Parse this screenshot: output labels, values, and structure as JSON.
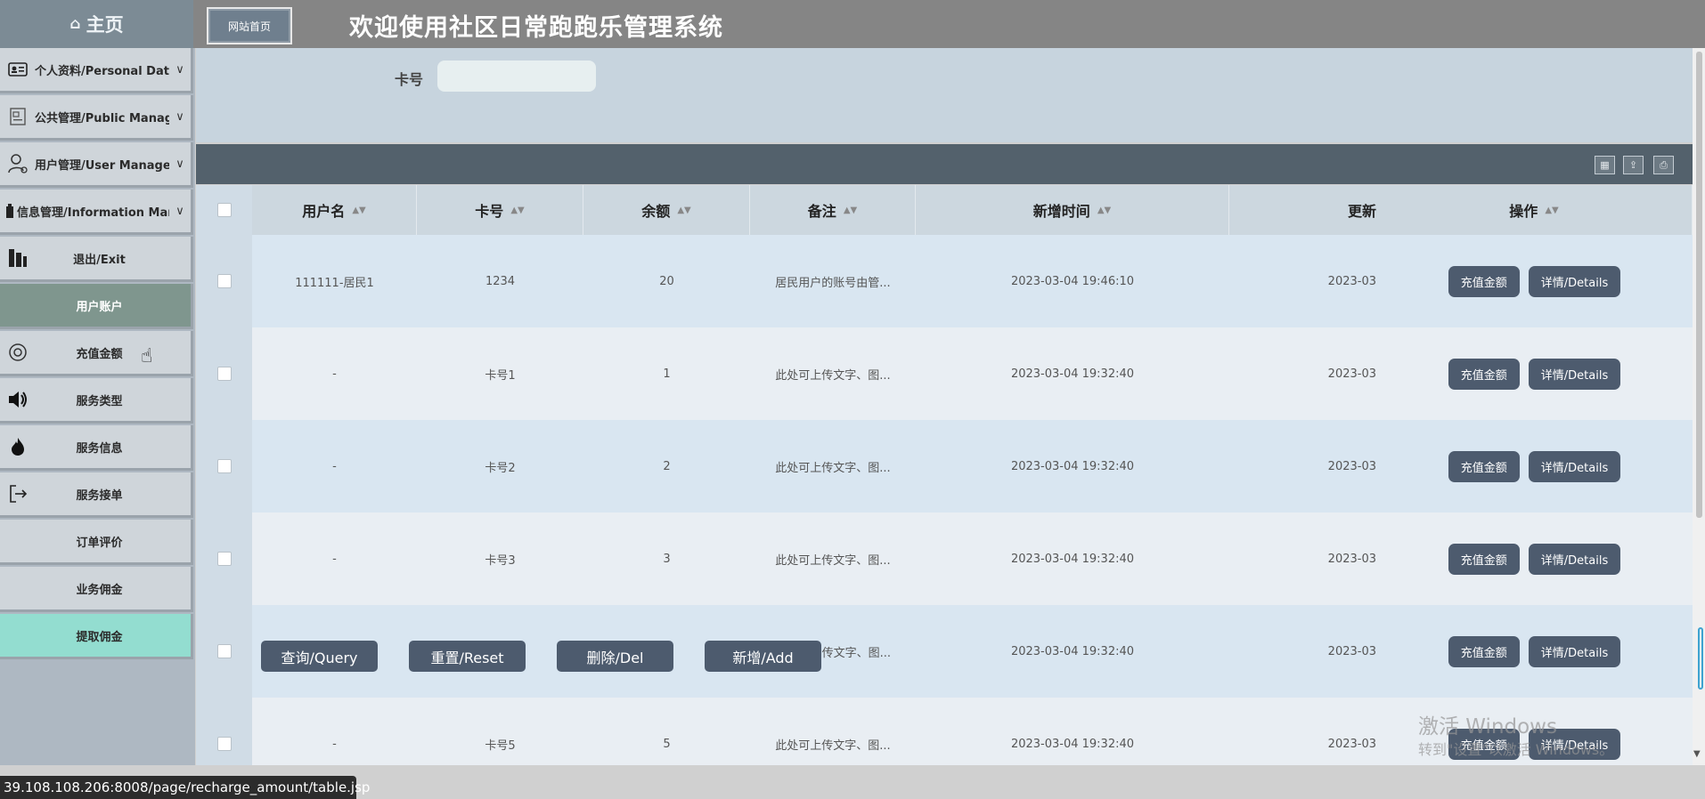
{
  "app": {
    "home": "主页",
    "site_button": "网站首页",
    "title": "欢迎使用社区日常跑跑乐管理系统"
  },
  "sidebar": {
    "groups": [
      {
        "label": "个人资料/Personal Data",
        "icon": "id-card-icon"
      },
      {
        "label": "公共管理/Public Manage",
        "icon": "document-icon"
      },
      {
        "label": "用户管理/User Manage",
        "icon": "user-gear-icon"
      },
      {
        "label": "信息管理/Information Man...",
        "icon": "building-icon"
      }
    ],
    "items": [
      {
        "label": "退出/Exit",
        "icon": "exit-icon"
      },
      {
        "label": "用户账户",
        "icon": ""
      },
      {
        "label": "充值金额",
        "icon": "ring-icon"
      },
      {
        "label": "服务类型",
        "icon": "speaker-icon"
      },
      {
        "label": "服务信息",
        "icon": "flame-icon"
      },
      {
        "label": "服务接单",
        "icon": "logout-icon"
      },
      {
        "label": "订单评价",
        "icon": ""
      },
      {
        "label": "业务佣金",
        "icon": ""
      },
      {
        "label": "提取佣金",
        "icon": ""
      }
    ]
  },
  "search": {
    "label": "卡号",
    "placeholder": ""
  },
  "table": {
    "headers": [
      "用户名",
      "卡号",
      "余额",
      "备注",
      "新增时间",
      "更新",
      "操作"
    ],
    "rows": [
      {
        "user": "111111-居民1",
        "card": "1234",
        "balance": "20",
        "note": "居民用户的账号由管...",
        "created": "2023-03-04 19:46:10",
        "updated": "2023-03"
      },
      {
        "user": "-",
        "card": "卡号1",
        "balance": "1",
        "note": "此处可上传文字、图...",
        "created": "2023-03-04 19:32:40",
        "updated": "2023-03"
      },
      {
        "user": "-",
        "card": "卡号2",
        "balance": "2",
        "note": "此处可上传文字、图...",
        "created": "2023-03-04 19:32:40",
        "updated": "2023-03"
      },
      {
        "user": "-",
        "card": "卡号3",
        "balance": "3",
        "note": "此处可上传文字、图...",
        "created": "2023-03-04 19:32:40",
        "updated": "2023-03"
      },
      {
        "user": "",
        "card": "",
        "balance": "",
        "note": "传文字、图...",
        "created": "2023-03-04 19:32:40",
        "updated": "2023-03"
      },
      {
        "user": "-",
        "card": "卡号5",
        "balance": "5",
        "note": "此处可上传文字、图...",
        "created": "2023-03-04 19:32:40",
        "updated": "2023-03"
      }
    ],
    "row_actions": {
      "recharge": "充值金额",
      "details": "详情/Details"
    }
  },
  "actions": {
    "query": "查询/Query",
    "reset": "重置/Reset",
    "delete": "删除/Del",
    "add": "新增/Add"
  },
  "status_url": "39.108.108.206:8008/page/recharge_amount/table.jsp",
  "watermark": {
    "line1": "激活 Windows",
    "line2": "转到\"设置\"以激活 Windows。"
  }
}
